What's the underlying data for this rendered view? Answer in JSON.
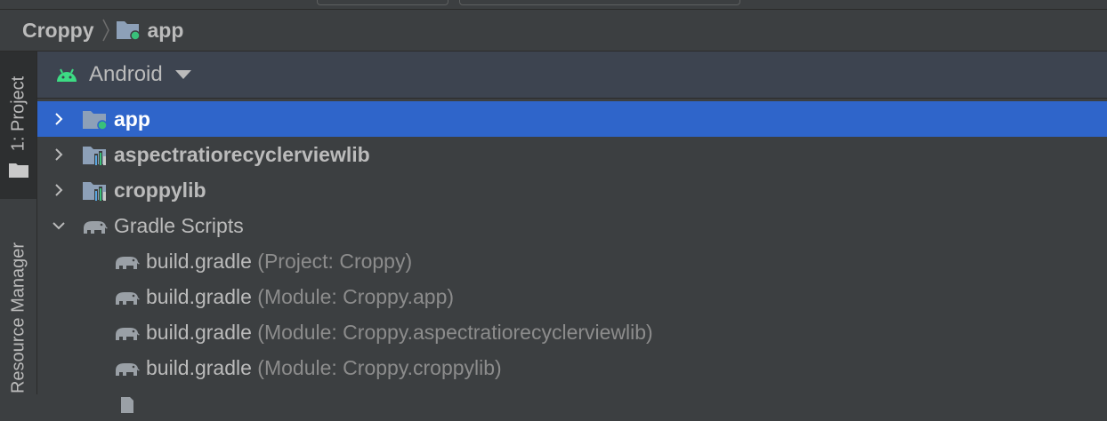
{
  "breadcrumb": {
    "root": "Croppy",
    "module": "app"
  },
  "tool_windows": {
    "project_tab": "1: Project",
    "resource_tab": "Resource Manager"
  },
  "project_panel": {
    "view_mode": "Android"
  },
  "tree": {
    "app": "app",
    "aspect": "aspectratiorecyclerviewlib",
    "croppylib": "croppylib",
    "gradle_scripts": "Gradle Scripts",
    "gradle_files": [
      {
        "name": "build.gradle",
        "detail": " (Project: Croppy)"
      },
      {
        "name": "build.gradle",
        "detail": " (Module: Croppy.app)"
      },
      {
        "name": "build.gradle",
        "detail": " (Module: Croppy.aspectratiorecyclerviewlib)"
      },
      {
        "name": "build.gradle",
        "detail": " (Module: Croppy.croppylib)"
      }
    ]
  },
  "colors": {
    "selection": "#2f65ca",
    "android_green": "#3ddc84",
    "module_dot": "#39c07a"
  },
  "icons": [
    "folder-icon",
    "android-icon",
    "module-folder-icon",
    "library-module-icon",
    "gradle-elephant-icon",
    "chevron-right-icon",
    "chevron-down-icon",
    "dropdown-arrow-icon"
  ]
}
